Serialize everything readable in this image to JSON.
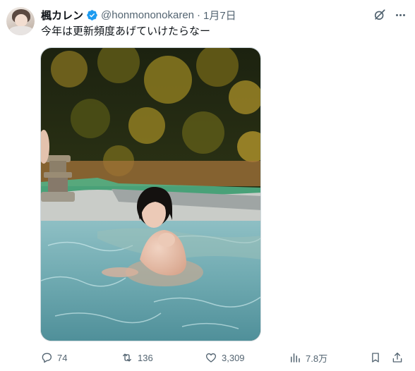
{
  "post": {
    "display_name": "楓カレン",
    "handle": "@honmononokaren",
    "separator": "·",
    "date": "1月7日",
    "text": "今年は更新頻度あげていけたらなー",
    "verified_icon": "verified-badge-icon",
    "grok_icon": "grok-icon",
    "more_icon": "more-icon"
  },
  "stats": {
    "replies": "74",
    "reposts": "136",
    "likes": "3,309",
    "views": "7.8万"
  },
  "icons": {
    "reply": "reply-icon",
    "repost": "repost-icon",
    "like": "like-icon",
    "views": "views-icon",
    "bookmark": "bookmark-icon",
    "share": "share-icon"
  },
  "colors": {
    "verified": "#1d9bf0",
    "secondary_text": "#536471",
    "primary_text": "#0f1419"
  }
}
